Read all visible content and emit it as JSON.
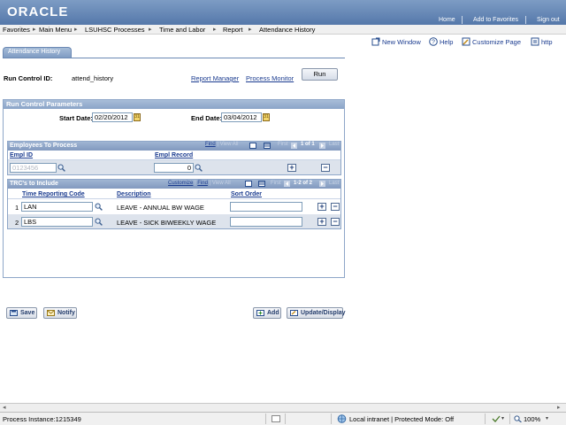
{
  "header": {
    "logo": "ORACLE",
    "links": [
      "Home",
      "Add to Favorites",
      "Sign out"
    ]
  },
  "breadcrumb": [
    "Favorites",
    "Main Menu",
    "LSUHSC Processes",
    "Time and Labor",
    "Report",
    "Attendance History"
  ],
  "page_actions": {
    "new_window": "New Window",
    "help": "Help",
    "customize": "Customize Page",
    "http": "http"
  },
  "tab": {
    "label": "Attendance History"
  },
  "run_control": {
    "label": "Run Control ID:",
    "value": "attend_history",
    "report_manager": "Report Manager",
    "process_monitor": "Process Monitor",
    "run_button": "Run"
  },
  "params": {
    "title": "Run Control Parameters",
    "start_label": "Start Date:",
    "start_value": "02/20/2012",
    "end_label": "End Date:",
    "end_value": "03/04/2012"
  },
  "employees_grid": {
    "title": "Employees To Process",
    "nav": {
      "find": "Find",
      "view_all": "View All",
      "first": "First",
      "count": "1 of 1",
      "last": "Last"
    },
    "col_emplid": "Empl ID",
    "col_record": "Empl Record",
    "emplid_value": "0123456",
    "record_value": "0"
  },
  "trc_grid": {
    "title": "TRC's to Include",
    "nav": {
      "customize": "Customize",
      "find": "Find",
      "view_all": "View All",
      "first": "First",
      "count": "1-2 of 2",
      "last": "Last"
    },
    "col_code": "Time Reporting Code",
    "col_desc": "Description",
    "col_sort": "Sort Order",
    "rows": [
      {
        "num": "1",
        "code": "LAN",
        "desc": "LEAVE - ANNUAL BW  WAGE",
        "sort": ""
      },
      {
        "num": "2",
        "code": "LBS",
        "desc": "LEAVE - SICK BIWEEKLY WAGE",
        "sort": ""
      }
    ]
  },
  "toolbar": {
    "save": "Save",
    "notify": "Notify",
    "add": "Add",
    "update": "Update/Display"
  },
  "statusbar": {
    "process_instance": "Process Instance:1215349",
    "zone": "Local intranet | Protected Mode: Off",
    "zoom": "100%"
  },
  "colors": {
    "header_bg": "#5578aa",
    "grid_header": "#8199bf",
    "link": "#1a3b8f"
  }
}
